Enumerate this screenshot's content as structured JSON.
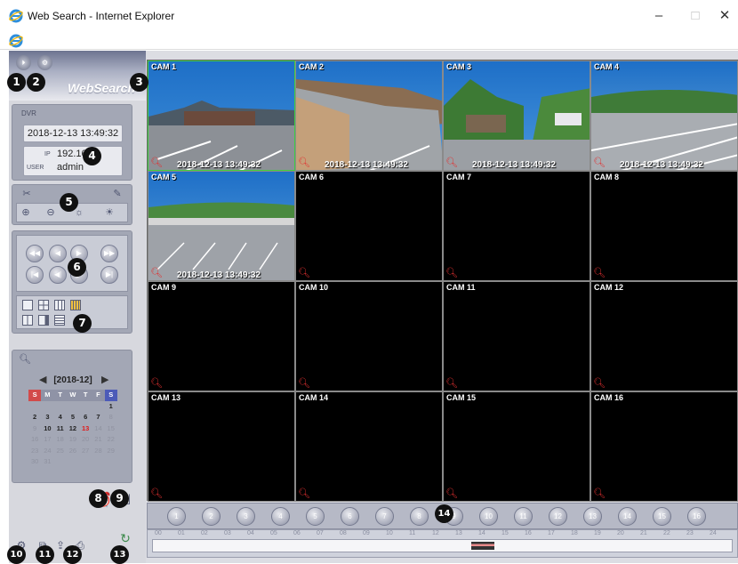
{
  "window": {
    "title": "Web Search - Internet Explorer",
    "minimize": "–",
    "maximize": "□",
    "close": "✕"
  },
  "brand": "WebSearch",
  "info": {
    "dvr_label": "DVR",
    "datetime": "2018-12-13 13:49:32",
    "ip_label": "IP",
    "ip": "192.168.",
    "user_label": "USER",
    "user": "admin"
  },
  "calendar": {
    "month": "[2018-12]",
    "prev": "◀",
    "next": "▶",
    "weekdays": [
      "S",
      "M",
      "T",
      "W",
      "T",
      "F",
      "S"
    ],
    "weeks": [
      [
        "",
        "",
        "",
        "",
        "",
        "",
        "1"
      ],
      [
        "2",
        "3",
        "4",
        "5",
        "6",
        "7",
        "8"
      ],
      [
        "9",
        "10",
        "11",
        "12",
        "13",
        "14",
        "15"
      ],
      [
        "16",
        "17",
        "18",
        "19",
        "20",
        "21",
        "22"
      ],
      [
        "23",
        "24",
        "25",
        "26",
        "27",
        "28",
        "29"
      ],
      [
        "30",
        "31",
        "",
        "",
        "",
        "",
        ""
      ]
    ],
    "today": "13"
  },
  "cameras": [
    {
      "name": "CAM 1",
      "ts": "2018-12-13 13:49:32"
    },
    {
      "name": "CAM 2",
      "ts": "2018-12-13 13:49:32"
    },
    {
      "name": "CAM 3",
      "ts": "2018-12-13 13:49:32"
    },
    {
      "name": "CAM 4",
      "ts": "2018-12-13 13:49:32"
    },
    {
      "name": "CAM 5",
      "ts": "2018-12-13 13:49:32"
    },
    {
      "name": "CAM 6",
      "ts": ""
    },
    {
      "name": "CAM 7",
      "ts": ""
    },
    {
      "name": "CAM 8",
      "ts": ""
    },
    {
      "name": "CAM 9",
      "ts": ""
    },
    {
      "name": "CAM 10",
      "ts": ""
    },
    {
      "name": "CAM 11",
      "ts": ""
    },
    {
      "name": "CAM 12",
      "ts": ""
    },
    {
      "name": "CAM 13",
      "ts": ""
    },
    {
      "name": "CAM 14",
      "ts": ""
    },
    {
      "name": "CAM 15",
      "ts": ""
    },
    {
      "name": "CAM 16",
      "ts": ""
    }
  ],
  "channels": [
    "1",
    "2",
    "3",
    "4",
    "5",
    "6",
    "7",
    "8",
    "9",
    "10",
    "11",
    "12",
    "13",
    "14",
    "15",
    "16"
  ],
  "timeline_hours": [
    "00",
    "01",
    "02",
    "03",
    "04",
    "05",
    "06",
    "07",
    "08",
    "09",
    "10",
    "11",
    "12",
    "13",
    "14",
    "15",
    "16",
    "17",
    "18",
    "19",
    "20",
    "21",
    "22",
    "23",
    "24"
  ],
  "badges": [
    "1",
    "2",
    "3",
    "4",
    "5",
    "6",
    "7",
    "8",
    "9",
    "10",
    "11",
    "12",
    "13",
    "14"
  ]
}
